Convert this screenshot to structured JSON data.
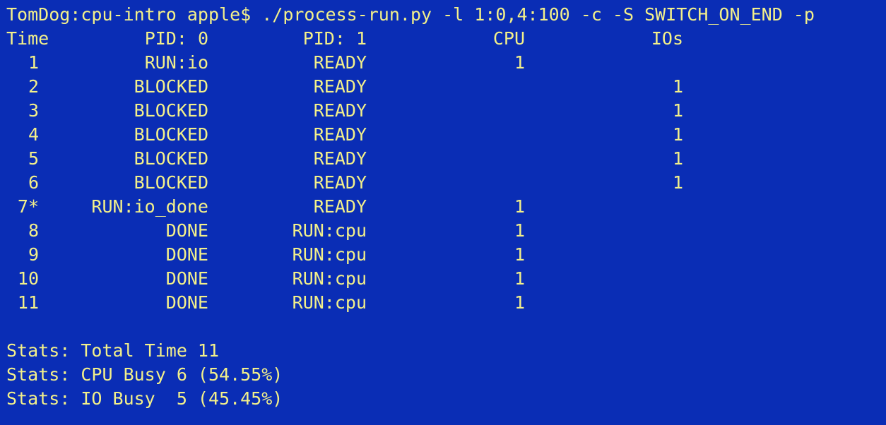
{
  "terminal": {
    "command_line": "TomDog:cpu-intro apple$ ./process-run.py -l 1:0,4:100 -c -S SWITCH_ON_END -p",
    "headers": {
      "time": "Time",
      "pid0": "PID: 0",
      "pid1": "PID: 1",
      "cpu": "CPU",
      "ios": "IOs"
    },
    "rows": [
      {
        "time": "1",
        "pid0": "RUN:io",
        "pid1": "READY",
        "cpu": "1",
        "ios": ""
      },
      {
        "time": "2",
        "pid0": "BLOCKED",
        "pid1": "READY",
        "cpu": "",
        "ios": "1"
      },
      {
        "time": "3",
        "pid0": "BLOCKED",
        "pid1": "READY",
        "cpu": "",
        "ios": "1"
      },
      {
        "time": "4",
        "pid0": "BLOCKED",
        "pid1": "READY",
        "cpu": "",
        "ios": "1"
      },
      {
        "time": "5",
        "pid0": "BLOCKED",
        "pid1": "READY",
        "cpu": "",
        "ios": "1"
      },
      {
        "time": "6",
        "pid0": "BLOCKED",
        "pid1": "READY",
        "cpu": "",
        "ios": "1"
      },
      {
        "time": "7*",
        "pid0": "RUN:io_done",
        "pid1": "READY",
        "cpu": "1",
        "ios": ""
      },
      {
        "time": "8",
        "pid0": "DONE",
        "pid1": "RUN:cpu",
        "cpu": "1",
        "ios": ""
      },
      {
        "time": "9",
        "pid0": "DONE",
        "pid1": "RUN:cpu",
        "cpu": "1",
        "ios": ""
      },
      {
        "time": "10",
        "pid0": "DONE",
        "pid1": "RUN:cpu",
        "cpu": "1",
        "ios": ""
      },
      {
        "time": "11",
        "pid0": "DONE",
        "pid1": "RUN:cpu",
        "cpu": "1",
        "ios": ""
      }
    ],
    "stats": [
      "Stats: Total Time 11",
      "Stats: CPU Busy 6 (54.55%)",
      "Stats: IO Busy  5 (45.45%)"
    ],
    "colors": {
      "background": "#0a2db5",
      "foreground": "#f3f08a"
    }
  }
}
